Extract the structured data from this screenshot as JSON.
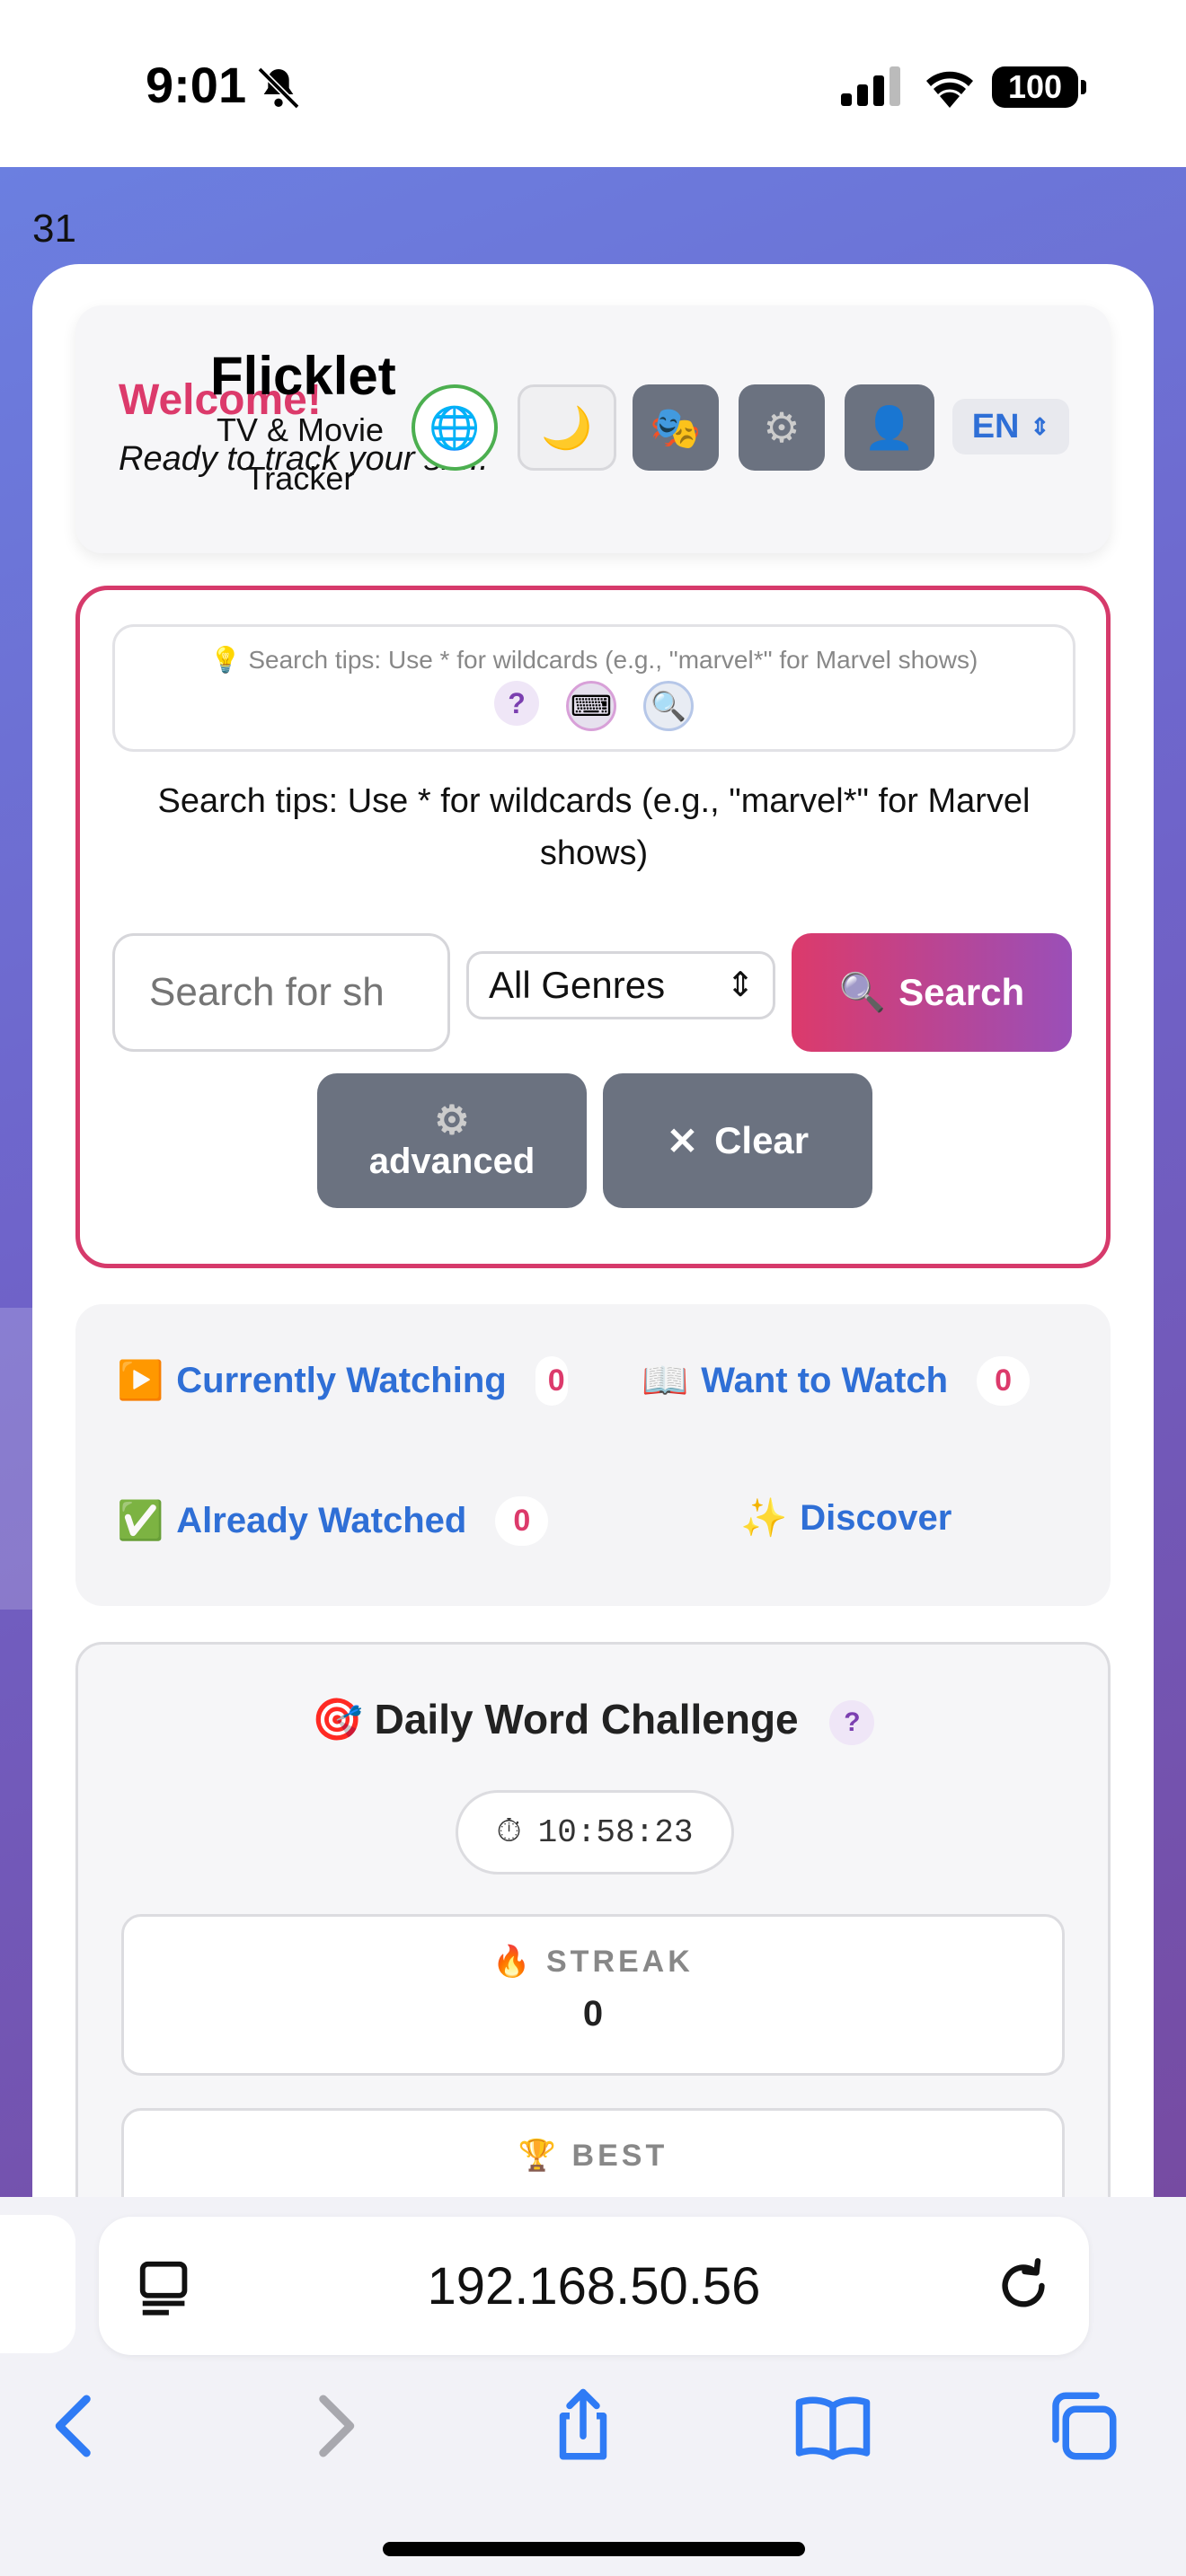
{
  "status_bar": {
    "time": "9:01",
    "battery": "100"
  },
  "page": {
    "corner_number": "31"
  },
  "header": {
    "welcome": "Welcome!",
    "greeting": "Ready to track your sh...",
    "brand_title": "Flicklet",
    "brand_subtitle": "TV & Movie Tracker",
    "language": "EN",
    "icons": {
      "globe": "globe-icon",
      "moon": "moon-icon",
      "mask": "theater-mask-icon",
      "gear": "gear-icon",
      "user": "user-icon"
    }
  },
  "search": {
    "tips_small": "💡 Search tips: Use * for wildcards (e.g., \"marvel*\" for Marvel shows)",
    "tips_large": "Search tips: Use * for wildcards (e.g., \"marvel*\" for Marvel shows)",
    "placeholder": "Search for sh",
    "genre_selected": "All Genres",
    "search_label": "Search",
    "advanced_label": "advanced",
    "clear_label": "Clear"
  },
  "tabs": [
    {
      "emoji": "▶️",
      "label": "Currently Watching",
      "count": "0"
    },
    {
      "emoji": "📖",
      "label": "Want to Watch",
      "count": "0"
    },
    {
      "emoji": "✅",
      "label": "Already Watched",
      "count": "0"
    },
    {
      "emoji": "✨",
      "label": "Discover"
    }
  ],
  "challenge": {
    "title": "Daily Word Challenge",
    "timer": "10:58:23",
    "streak_label": "STREAK",
    "streak_value": "0",
    "best_label": "BEST"
  },
  "browser": {
    "url": "192.168.50.56"
  },
  "colors": {
    "accent_pink": "#dc3a6b",
    "link_blue": "#2f6fd6",
    "button_gray": "#6b7280"
  }
}
